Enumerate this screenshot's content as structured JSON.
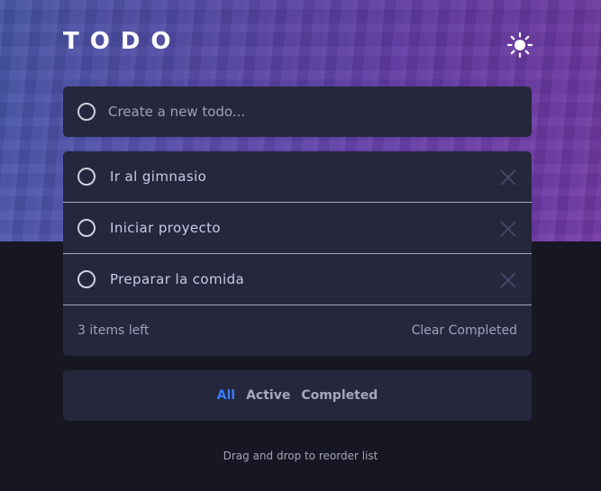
{
  "app": {
    "title": "TODO",
    "theme_icon": "sun-icon"
  },
  "new_todo": {
    "placeholder": "Create a new todo..."
  },
  "todos": [
    {
      "text": "Ir al gimnasio",
      "completed": false
    },
    {
      "text": "Iniciar proyecto",
      "completed": false
    },
    {
      "text": "Preparar la comida",
      "completed": false
    }
  ],
  "footer": {
    "items_left": "3 items left",
    "clear_label": "Clear Completed"
  },
  "filters": {
    "all": "All",
    "active": "Active",
    "completed": "Completed",
    "selected": "All"
  },
  "hint": "Drag and drop to reorder list",
  "colors": {
    "accent": "#3a7bfd",
    "card": "#25273c",
    "background": "#161722",
    "text": "#c8cbe7"
  }
}
